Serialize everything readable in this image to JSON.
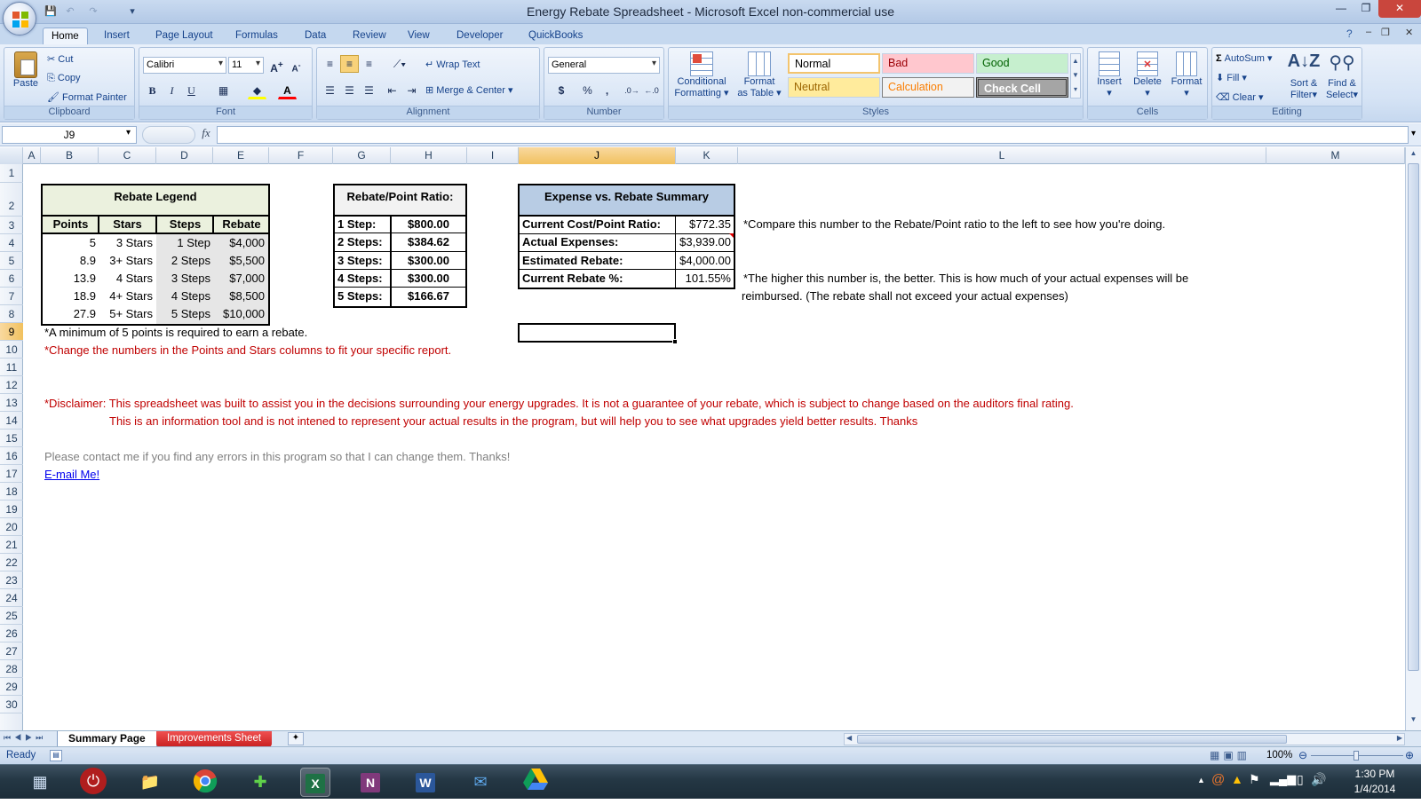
{
  "window": {
    "title": "Energy Rebate Spreadsheet - Microsoft Excel non-commercial use"
  },
  "tabs": [
    "Home",
    "Insert",
    "Page Layout",
    "Formulas",
    "Data",
    "Review",
    "View",
    "Developer",
    "QuickBooks"
  ],
  "ribbon": {
    "clipboard": {
      "paste": "Paste",
      "cut": "Cut",
      "copy": "Copy",
      "format_painter": "Format Painter",
      "label": "Clipboard"
    },
    "font": {
      "name": "Calibri",
      "size": "11",
      "bold": "B",
      "italic": "I",
      "underline": "U",
      "label": "Font"
    },
    "alignment": {
      "wrap": "Wrap Text",
      "merge": "Merge & Center",
      "label": "Alignment"
    },
    "number": {
      "format": "General",
      "dollar": "$",
      "percent": "%",
      "comma": ",",
      "label": "Number"
    },
    "styles": {
      "conditional": "Conditional",
      "conditional2": "Formatting",
      "format_table": "Format",
      "format_table2": "as Table",
      "normal": "Normal",
      "bad": "Bad",
      "good": "Good",
      "neutral": "Neutral",
      "calculation": "Calculation",
      "check_cell": "Check Cell",
      "label": "Styles"
    },
    "cells": {
      "insert": "Insert",
      "delete": "Delete",
      "format": "Format",
      "label": "Cells"
    },
    "editing": {
      "autosum": "AutoSum",
      "fill": "Fill",
      "clear": "Clear",
      "sort": "Sort &",
      "sort2": "Filter",
      "find": "Find &",
      "find2": "Select",
      "label": "Editing"
    }
  },
  "formula_bar": {
    "name_box": "J9",
    "fx": "fx",
    "value": ""
  },
  "columns": [
    "A",
    "B",
    "C",
    "D",
    "E",
    "F",
    "G",
    "H",
    "I",
    "J",
    "K",
    "L",
    "M"
  ],
  "rows": [
    "1",
    "2",
    "3",
    "4",
    "5",
    "6",
    "7",
    "8",
    "9",
    "10",
    "11",
    "12",
    "13",
    "14",
    "15",
    "16",
    "17",
    "18",
    "19",
    "20",
    "21",
    "22",
    "23",
    "24",
    "25",
    "26",
    "27",
    "28",
    "29",
    "30"
  ],
  "legend": {
    "title": "Rebate Legend",
    "headers": [
      "Points",
      "Stars",
      "Steps",
      "Rebate"
    ],
    "rows": [
      [
        "5",
        "3 Stars",
        "1 Step",
        "$4,000"
      ],
      [
        "8.9",
        "3+ Stars",
        "2 Steps",
        "$5,500"
      ],
      [
        "13.9",
        "4 Stars",
        "3 Steps",
        "$7,000"
      ],
      [
        "18.9",
        "4+ Stars",
        "4 Steps",
        "$8,500"
      ],
      [
        "27.9",
        "5+ Stars",
        "5 Steps",
        "$10,000"
      ]
    ]
  },
  "ratio": {
    "title": "Rebate/Point Ratio:",
    "rows": [
      [
        "1 Step:",
        "$800.00"
      ],
      [
        "2 Steps:",
        "$384.62"
      ],
      [
        "3 Steps:",
        "$300.00"
      ],
      [
        "4 Steps:",
        "$300.00"
      ],
      [
        "5 Steps:",
        "$166.67"
      ]
    ]
  },
  "summary": {
    "title": "Expense vs. Rebate Summary",
    "rows": [
      [
        "Current Cost/Point Ratio:",
        "$772.35"
      ],
      [
        "Actual Expenses:",
        "$3,939.00"
      ],
      [
        "Estimated Rebate:",
        "$4,000.00"
      ],
      [
        "Current Rebate %:",
        "101.55%"
      ]
    ]
  },
  "notes": {
    "compare": "*Compare this number to the Rebate/Point ratio to the left to see how you're doing.",
    "higher1": "*The higher this number is, the better. This is how much of your actual expenses will be",
    "higher2": "reimbursed. (The rebate shall not exceed your actual expenses)",
    "minimum": "*A minimum of 5 points is required to earn a rebate.",
    "change": "*Change the numbers in the Points and Stars columns to fit your specific report.",
    "disclaimer1": "*Disclaimer: This spreadsheet was built to assist you in the decisions surrounding your energy upgrades. It is not a guarantee of your rebate, which is subject to change based on the auditors final rating.",
    "disclaimer2": "This is an information tool and is not intened to represent your actual results in the program, but will help you to see what upgrades yield better results. Thanks",
    "contact": "Please contact me if you find any errors in this program so that I can change them. Thanks!",
    "email": "E-mail Me!"
  },
  "sheets": [
    "Summary Page",
    "Improvements Sheet"
  ],
  "status": {
    "ready": "Ready",
    "zoom": "100%"
  },
  "clock": {
    "time": "1:30 PM",
    "date": "1/4/2014"
  },
  "colors": {
    "legend_fill": "#ebf1de",
    "summary_fill": "#b8cce4",
    "ratio_fill": "#f2f2f2",
    "red_text": "#c00000",
    "selection": "#f1c15f"
  }
}
